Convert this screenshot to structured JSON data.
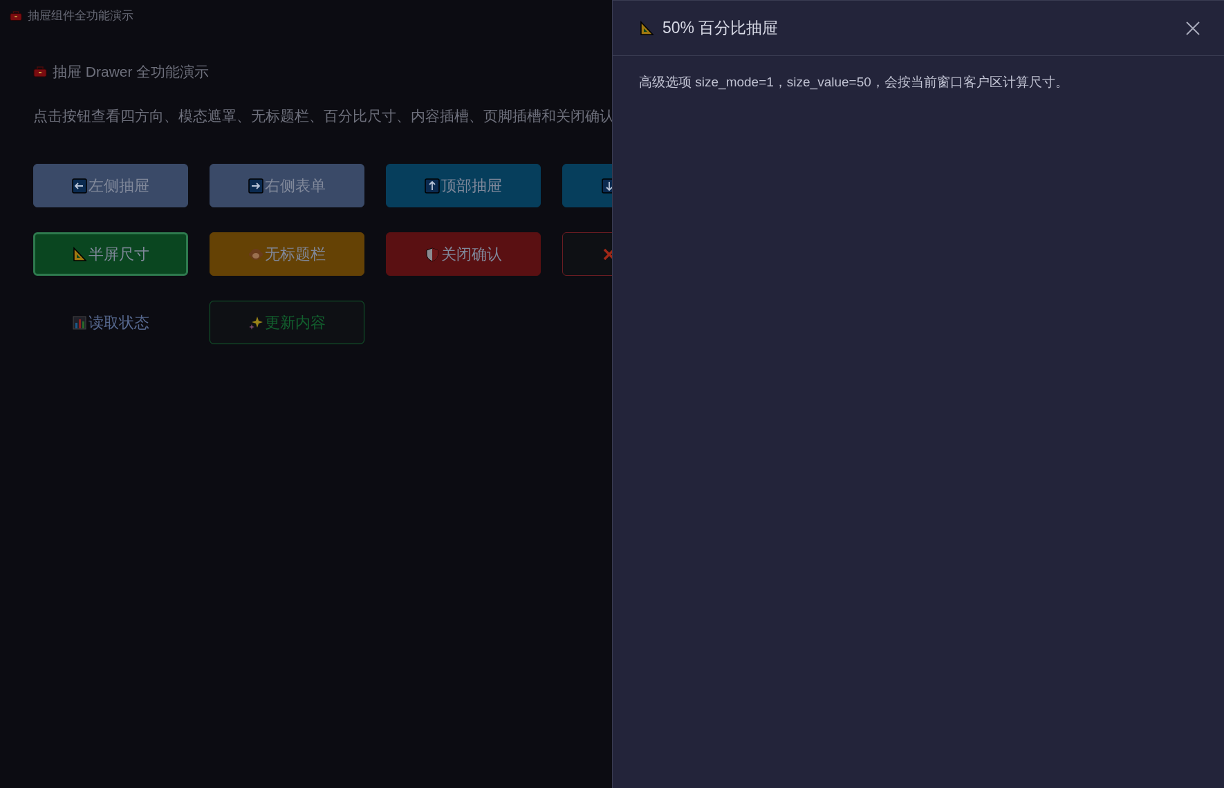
{
  "window": {
    "title": "抽屉组件全功能演示"
  },
  "page": {
    "heading": "抽屉 Drawer 全功能演示",
    "description": "点击按钮查看四方向、模态遮罩、无标题栏、百分比尺寸、内容插槽、页脚插槽和关闭确认"
  },
  "buttons": [
    {
      "kind": "filled",
      "label": "左侧抽屉",
      "color": "#3a4a68",
      "selected": false
    },
    {
      "kind": "filled",
      "label": "右侧表单",
      "color": "#3a4a68",
      "selected": false
    },
    {
      "kind": "filled",
      "label": "顶部抽屉",
      "color": "#063e5c",
      "selected": false
    },
    {
      "kind": "filled",
      "color": "#063e5c",
      "selected": false
    },
    {
      "kind": "filled",
      "label": "半屏尺寸",
      "color": "#0a4620",
      "selected": true
    },
    {
      "kind": "filled",
      "label": "无标题栏",
      "color": "#654205",
      "selected": false
    },
    {
      "kind": "filled",
      "label": "关闭确认",
      "color": "#5a1012",
      "selected": false
    },
    {
      "kind": "outline",
      "color": "#6a1c22",
      "selected": false
    },
    {
      "kind": "text",
      "label": "读取状态",
      "color": "#56688e",
      "selected": false
    },
    {
      "kind": "outline",
      "label": "更新内容",
      "color": "#12602e",
      "selected": false
    }
  ],
  "drawer": {
    "title": "50% 百分比抽屉",
    "body": "高级选项 size_mode=1，size_value=50，会按当前窗口客户区计算尺寸。"
  }
}
